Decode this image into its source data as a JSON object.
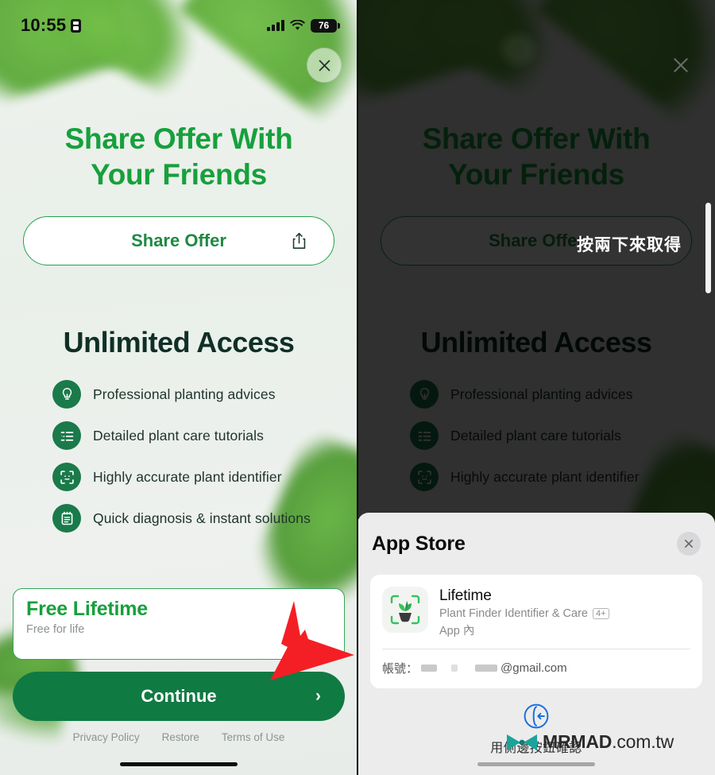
{
  "statusbar": {
    "time": "10:55",
    "recording_icon": "screen-record-icon",
    "signal_icon": "cellular-signal-icon",
    "wifi_icon": "wifi-icon",
    "battery_level": "76"
  },
  "paywall": {
    "close_icon": "close-icon",
    "headline_line1": "Share Offer With",
    "headline_line2": "Your Friends",
    "share_button_label": "Share Offer",
    "share_icon": "share-icon",
    "section_title": "Unlimited Access",
    "features": [
      {
        "icon": "lightbulb-icon",
        "label": "Professional planting advices"
      },
      {
        "icon": "checklist-icon",
        "label": "Detailed plant care tutorials"
      },
      {
        "icon": "scan-frame-icon",
        "label": "Highly accurate plant identifier"
      },
      {
        "icon": "notepad-icon",
        "label": "Quick diagnosis & instant solutions"
      }
    ],
    "plan": {
      "title": "Free Lifetime",
      "subtitle": "Free for life"
    },
    "continue_label": "Continue",
    "continue_chevron": "›",
    "legal": [
      "Privacy Policy",
      "Restore",
      "Terms of Use"
    ]
  },
  "annotation": {
    "arrow": "red-arrow-pointing-to-continue-button"
  },
  "right_panel": {
    "dim_close_icon": "close-icon",
    "press_hint": "按兩下來取得",
    "side_button_indicator": "side-button-bar"
  },
  "app_store_sheet": {
    "title": "App Store",
    "close_icon": "close-icon",
    "app": {
      "icon": "plant-scan-app-icon",
      "name": "Lifetime",
      "description": "Plant Finder Identifier & Care",
      "age_rating": "4+",
      "in_app": "App 內"
    },
    "account_label": "帳號：",
    "account_email": "@gmail.com",
    "confirm_icon": "side-button-confirm-icon",
    "confirm_text": "用側邊按鈕確認"
  },
  "watermark": {
    "brand": "MRMAD",
    "suffix": ".com.tw",
    "logo": "bowtie-logo"
  },
  "colors": {
    "brand_green": "#17a03c",
    "deep_green": "#107a43",
    "icon_green": "#1a7a4a",
    "dark_text": "#0f2f27",
    "arrow_red": "#f41f24"
  }
}
